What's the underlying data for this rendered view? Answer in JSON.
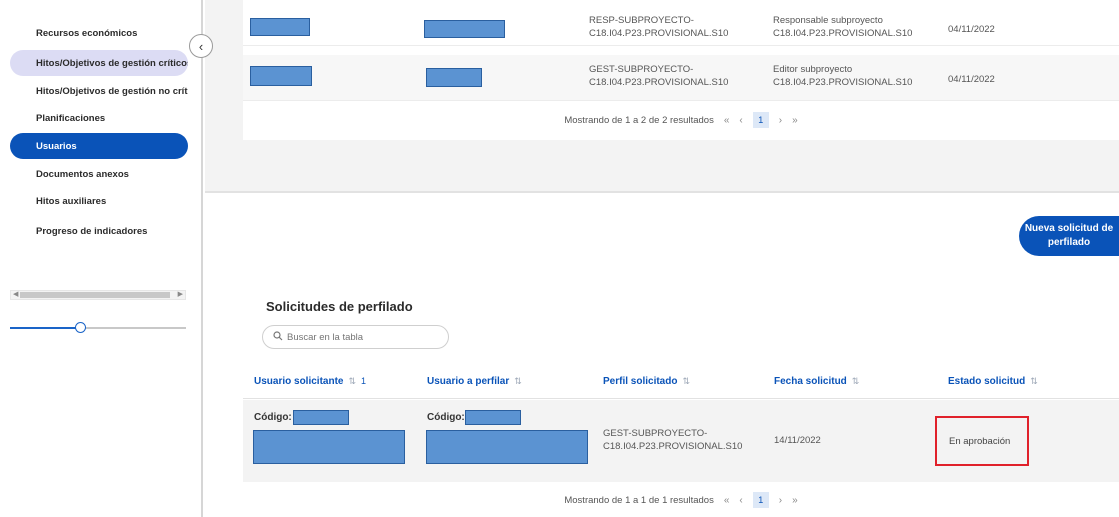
{
  "sidebar": {
    "items": [
      {
        "label": "Recursos económicos",
        "state": "normal"
      },
      {
        "label": "Hitos/Objetivos de gestión críticos",
        "state": "highlight"
      },
      {
        "label": "Hitos/Objetivos de gestión no críticos",
        "state": "normal"
      },
      {
        "label": "Planificaciones",
        "state": "normal"
      },
      {
        "label": "Usuarios",
        "state": "active"
      },
      {
        "label": "Documentos anexos",
        "state": "normal"
      },
      {
        "label": "Hitos auxiliares",
        "state": "normal"
      },
      {
        "label": "Progreso de indicadores",
        "state": "normal"
      }
    ],
    "collapse_icon": "chevron-left-icon",
    "zoom_slider_level": 0.4
  },
  "top_table": {
    "rows": [
      {
        "profile_code": "RESP-SUBPROYECTO-C18.I04.P23.PROVISIONAL.S10",
        "profile_desc": "Responsable subproyecto C18.I04.P23.PROVISIONAL.S10",
        "date": "04/11/2022"
      },
      {
        "profile_code": "GEST-SUBPROYECTO-C18.I04.P23.PROVISIONAL.S10",
        "profile_desc": "Editor subproyecto C18.I04.P23.PROVISIONAL.S10",
        "date": "04/11/2022"
      }
    ],
    "pager": {
      "text": "Mostrando de 1 a 2 de 2 resultados",
      "page": "1"
    }
  },
  "new_request_button": "Nueva solicitud de perfilado",
  "requests": {
    "title": "Solicitudes de perfilado",
    "search_placeholder": "Buscar en la tabla",
    "columns": [
      "Usuario solicitante",
      "Usuario a perfilar",
      "Perfil solicitado",
      "Fecha solicitud",
      "Estado solicitud"
    ],
    "sort_active_index": "1",
    "rows": [
      {
        "solicitante_label": "Código:",
        "perfilar_label": "Código:",
        "perfil": "GEST-SUBPROYECTO-C18.I04.P23.PROVISIONAL.S10",
        "fecha": "14/11/2022",
        "estado": "En aprobación"
      }
    ],
    "pager": {
      "text": "Mostrando de 1 a 1 de 1 resultados",
      "page": "1"
    }
  },
  "colors": {
    "accent": "#0a53b8",
    "highlight_box": "#e0202a",
    "redaction": "#5b93d2"
  }
}
